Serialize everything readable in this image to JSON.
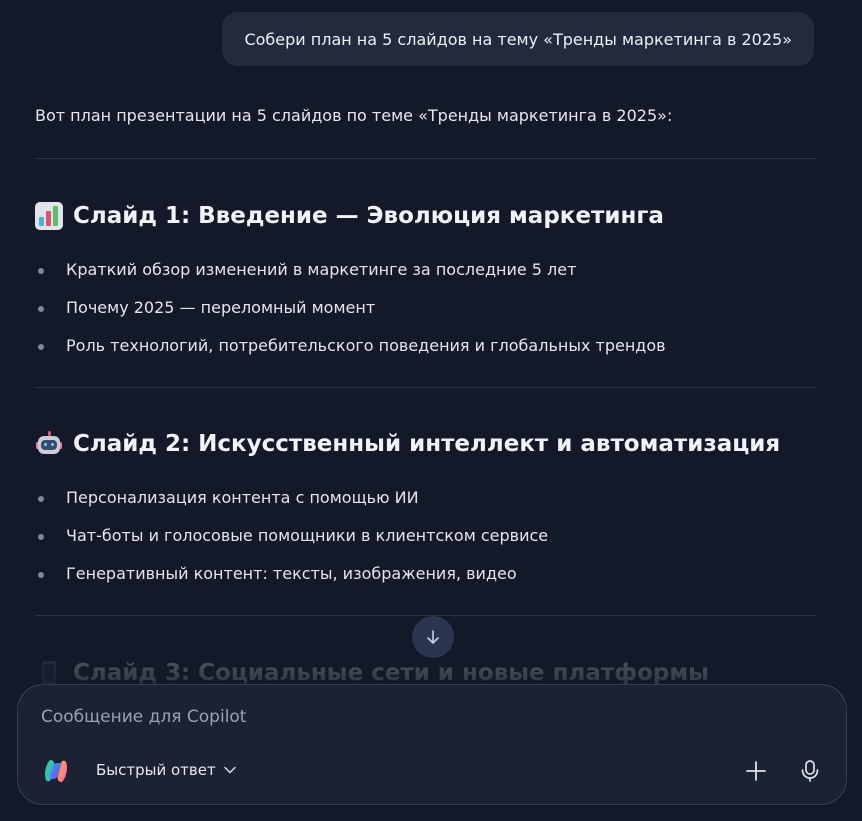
{
  "user_message": "Собери план на 5 слайдов на тему «Тренды маркетинга в 2025»",
  "answer": {
    "intro": "Вот план презентации на 5 слайдов по теме «Тренды маркетинга в 2025»:",
    "slides": [
      {
        "icon": "bar-chart-icon",
        "title": "Слайд 1: Введение — Эволюция маркетинга",
        "bullets": [
          "Краткий обзор изменений в маркетинге за последние 5 лет",
          "Почему 2025 — переломный момент",
          "Роль технологий, потребительского поведения и глобальных трендов"
        ]
      },
      {
        "icon": "robot-icon",
        "title": "Слайд 2: Искусственный интеллект и автоматизация",
        "bullets": [
          "Персонализация контента с помощью ИИ",
          "Чат-боты и голосовые помощники в клиентском сервисе",
          "Генеративный контент: тексты, изображения, видео"
        ]
      },
      {
        "icon": "mobile-phone-icon",
        "title": "Слайд 3: Социальные сети и новые платформы"
      }
    ]
  },
  "composer": {
    "placeholder": "Сообщение для Copilot",
    "mode_label": "Быстрый ответ"
  },
  "colors": {
    "background": "#131928",
    "bubble": "#232a3d",
    "composer": "#1c2233",
    "scroll_button": "#2c3550"
  }
}
